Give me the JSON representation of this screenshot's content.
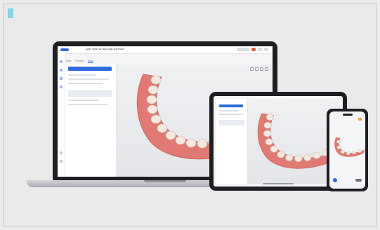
{
  "laptop": {
    "window_title": "Арр·Улуп·Щ·ЩЫ·ЩЬ·ЩЯ·ЩЯ",
    "tabs": [
      "Start",
      "Review",
      "Scan"
    ],
    "active_tab": 2,
    "panel_button": "",
    "colors": {
      "accent": "#2d6cdf",
      "alert": "#ef5b3a",
      "gum": "#e07a72",
      "tooth": "#f3e9de"
    }
  },
  "tablet": {},
  "phone": {
    "accent_color": "#f0a33a"
  }
}
